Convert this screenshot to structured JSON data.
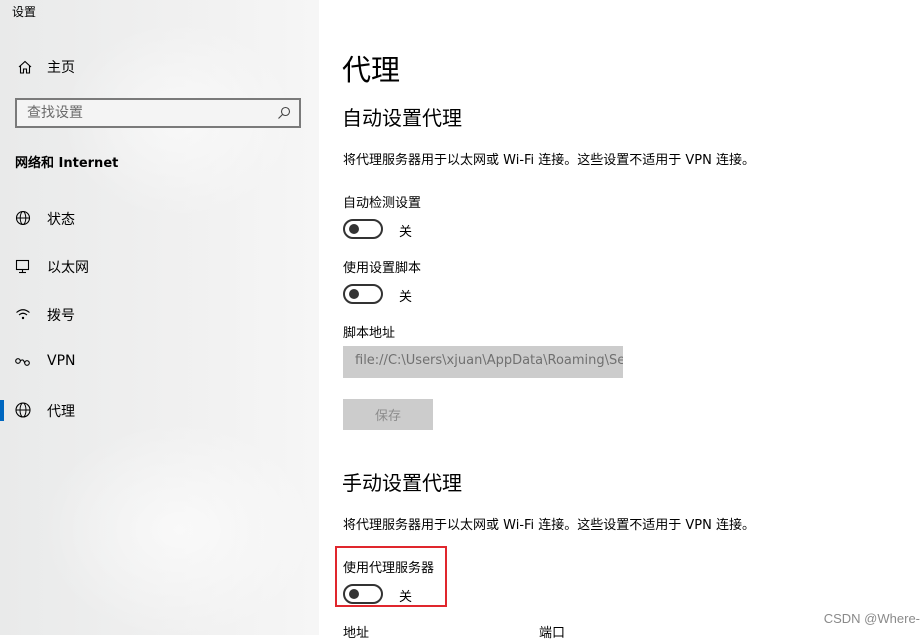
{
  "window": {
    "title": "设置"
  },
  "sidebar": {
    "home_label": "主页",
    "search": {
      "placeholder": "查找设置"
    },
    "section_label": "网络和 Internet",
    "items": [
      {
        "label": "状态",
        "icon": "globe-status-icon",
        "active": false
      },
      {
        "label": "以太网",
        "icon": "ethernet-icon",
        "active": false
      },
      {
        "label": "拨号",
        "icon": "dialup-icon",
        "active": false
      },
      {
        "label": "VPN",
        "icon": "vpn-icon",
        "active": false
      },
      {
        "label": "代理",
        "icon": "globe-icon",
        "active": true
      }
    ],
    "accent_color": "#0067c0"
  },
  "main": {
    "page_title": "代理",
    "auto": {
      "title": "自动设置代理",
      "description": "将代理服务器用于以太网或 Wi-Fi 连接。这些设置不适用于 VPN 连接。",
      "detect": {
        "label": "自动检测设置",
        "state": "关"
      },
      "script": {
        "label": "使用设置脚本",
        "state": "关"
      },
      "address": {
        "label": "脚本地址",
        "value": "file://C:\\Users\\xjuan\\AppData\\Roaming\\Se"
      },
      "save_label": "保存"
    },
    "manual": {
      "title": "手动设置代理",
      "description": "将代理服务器用于以太网或 Wi-Fi 连接。这些设置不适用于 VPN 连接。",
      "use_proxy": {
        "label": "使用代理服务器",
        "state": "关"
      },
      "address_label": "地址",
      "port_label": "端口"
    },
    "highlight_color": "#e0262d"
  },
  "watermark": "CSDN @Where-"
}
